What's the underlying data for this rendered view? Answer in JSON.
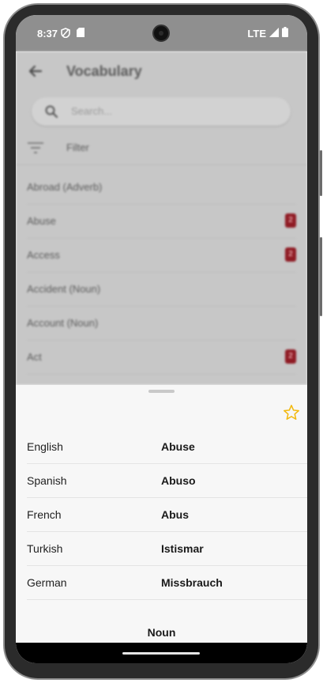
{
  "status": {
    "time": "8:37",
    "network": "LTE"
  },
  "app": {
    "title": "Vocabulary",
    "search_placeholder": "Search...",
    "filter_label": "Filter",
    "items": [
      {
        "label": "Abroad (Adverb)",
        "badge": ""
      },
      {
        "label": "Abuse",
        "badge": "2"
      },
      {
        "label": "Access",
        "badge": "2"
      },
      {
        "label": "Accident (Noun)",
        "badge": ""
      },
      {
        "label": "Account (Noun)",
        "badge": ""
      },
      {
        "label": "Act",
        "badge": "2"
      }
    ]
  },
  "sheet": {
    "favorite_icon": "star-outline-icon",
    "translations": [
      {
        "language": "English",
        "word": "Abuse"
      },
      {
        "language": "Spanish",
        "word": "Abuso"
      },
      {
        "language": "French",
        "word": "Abus"
      },
      {
        "language": "Turkish",
        "word": "Istismar"
      },
      {
        "language": "German",
        "word": "Missbrauch"
      }
    ],
    "part_of_speech": "Noun",
    "scroll_progress": 0.5
  },
  "colors": {
    "badge": "#8f1b24",
    "star": "#f2b90f",
    "sheet_background": "#f7f7f7"
  }
}
